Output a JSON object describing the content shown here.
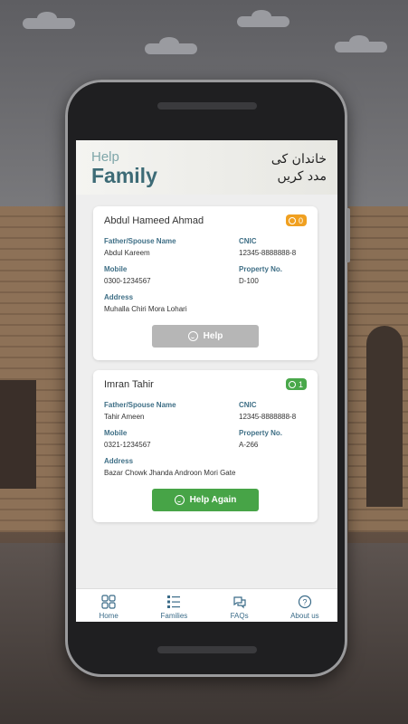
{
  "header": {
    "help": "Help",
    "family": "Family",
    "urdu_line1": "خاندان کی",
    "urdu_line2": "مدد کریں"
  },
  "families": [
    {
      "name": "Abdul Hameed Ahmad",
      "count": "0",
      "father_label": "Father/Spouse Name",
      "father": "Abdul Kareem",
      "cnic_label": "CNIC",
      "cnic": "12345-8888888-8",
      "mobile_label": "Mobile",
      "mobile": "0300-1234567",
      "property_label": "Property No.",
      "property": "D-100",
      "address_label": "Address",
      "address": "Muhalla Chiri Mora Lohari",
      "button": "Help"
    },
    {
      "name": "Imran Tahir",
      "count": "1",
      "father_label": "Father/Spouse Name",
      "father": "Tahir Ameen",
      "cnic_label": "CNIC",
      "cnic": "12345-8888888-8",
      "mobile_label": "Mobile",
      "mobile": "0321-1234567",
      "property_label": "Property No.",
      "property": "A-266",
      "address_label": "Address",
      "address": "Bazar Chowk Jhanda Androon Mori Gate",
      "button": "Help Again"
    }
  ],
  "nav": {
    "home": "Home",
    "families": "Families",
    "faqs": "FAQs",
    "about": "About us"
  },
  "colors": {
    "accent": "#3d6b76",
    "orange": "#f0a020",
    "green": "#47a447",
    "gray": "#b6b6b6"
  }
}
